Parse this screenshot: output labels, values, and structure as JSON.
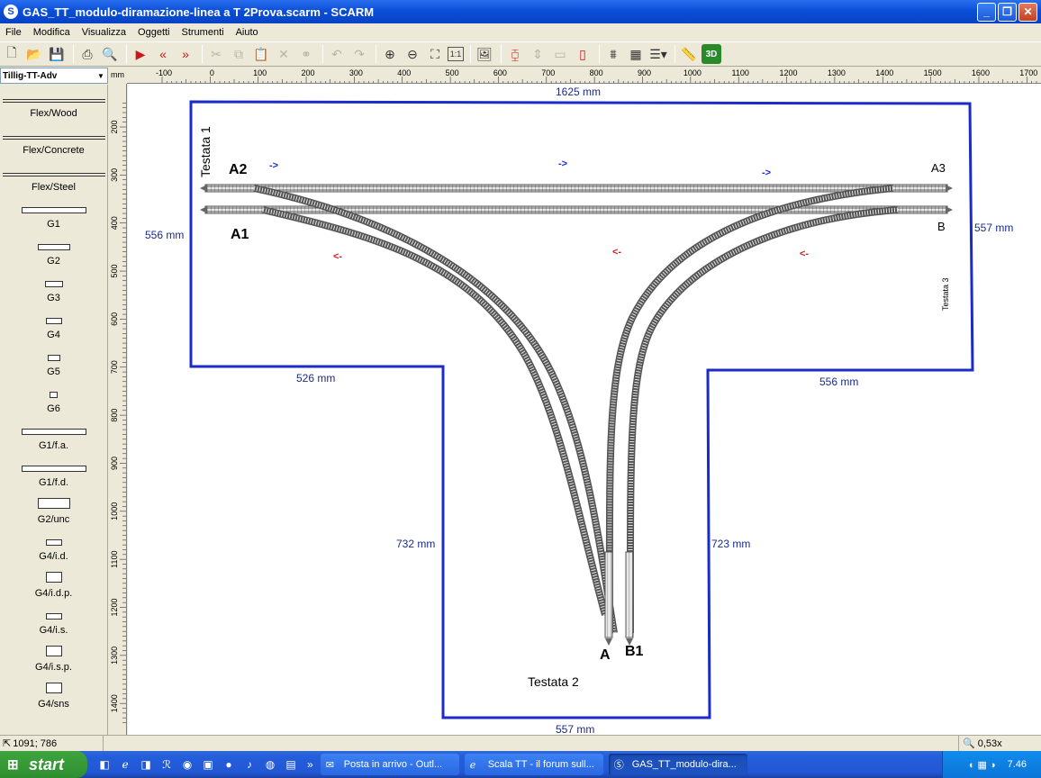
{
  "window": {
    "title": "GAS_TT_modulo-diramazione-linea a T 2Prova.scarm - SCARM",
    "app_icon": "S",
    "buttons": {
      "minimize": "_",
      "maximize": "❐",
      "close": "✕"
    }
  },
  "menu": [
    "File",
    "Modifica",
    "Visualizza",
    "Oggetti",
    "Strumenti",
    "Aiuto"
  ],
  "toolbar": {
    "icons": [
      "new-file-icon",
      "open-folder-icon",
      "save-icon",
      "print-icon",
      "print-preview-icon",
      "run-icon",
      "rewind-icon",
      "forward-icon",
      "cut-icon",
      "copy-icon",
      "paste-icon",
      "delete-icon",
      "link-icon",
      "undo-icon",
      "redo-icon",
      "zoom-in-icon",
      "zoom-out-icon",
      "zoom-fit-icon",
      "zoom-1to1-icon",
      "image-icon",
      "track-red-icon",
      "track-height-icon",
      "track-section-icon",
      "track-isolate-icon",
      "bridge-icon",
      "grid-icon",
      "layers-icon",
      "measure-icon",
      "view-3d-icon"
    ],
    "view3d_label": "3D",
    "zoom11_label": "1:1"
  },
  "library": {
    "selected": "Tillig-TT-Adv",
    "items": [
      "Flex/Wood",
      "Flex/Concrete",
      "Flex/Steel",
      "G1",
      "G2",
      "G3",
      "G4",
      "G5",
      "G6",
      "G1/f.a.",
      "G1/f.d.",
      "G2/unc",
      "G4/i.d.",
      "G4/i.d.p.",
      "G4/i.s.",
      "G4/i.s.p.",
      "G4/sns"
    ]
  },
  "ruler": {
    "unit": "mm",
    "h_labels": [
      "-100",
      "0",
      "100",
      "200",
      "300",
      "400",
      "500",
      "600",
      "700",
      "800",
      "900",
      "1000",
      "1100",
      "1200",
      "1300",
      "1400",
      "1500",
      "1600",
      "1700"
    ],
    "v_labels": [
      "200",
      "300",
      "400",
      "500",
      "600",
      "700",
      "800",
      "900",
      "1000",
      "1100",
      "1200",
      "1300",
      "1400"
    ]
  },
  "canvas": {
    "dimensions": {
      "top": "1625 mm",
      "left": "556 mm",
      "right": "557 mm",
      "inner_left": "526 mm",
      "inner_right": "556 mm",
      "stem_left": "732 mm",
      "stem_right": "723 mm",
      "bottom": "557 mm"
    },
    "labels": {
      "a2": "A2",
      "a1": "A1",
      "a3": "A3",
      "b": "B",
      "a": "A",
      "b1": "B1",
      "testata1": "Testata 1",
      "testata2": "Testata 2",
      "testata3": "Testata 3"
    },
    "direction_arrows": {
      "blue_1": "->",
      "blue_2": "->",
      "blue_3": "->",
      "red_1": "<-",
      "red_2": "<-",
      "red_3": "<-"
    },
    "colors": {
      "outline": "#1a2bc8",
      "dimension_text": "#1a2b8a",
      "track": "#555555"
    }
  },
  "status": {
    "coords": "1091; 786",
    "zoom": "0,53x"
  },
  "taskbar": {
    "start": "start",
    "tasks": [
      "Posta in arrivo - Outl...",
      "Scala TT - il forum sull...",
      "GAS_TT_modulo-dira..."
    ],
    "clock": "7.46"
  }
}
